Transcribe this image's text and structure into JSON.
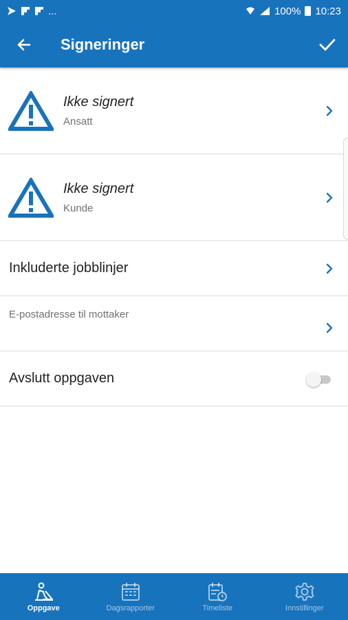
{
  "status_bar": {
    "battery": "100%",
    "time": "10:23",
    "more_notifications": "..."
  },
  "app_bar": {
    "title": "Signeringer"
  },
  "signatures": [
    {
      "status": "Ikke signert",
      "role": "Ansatt"
    },
    {
      "status": "Ikke signert",
      "role": "Kunde"
    }
  ],
  "included_lines": {
    "label": "Inkluderte jobblinjer"
  },
  "email": {
    "label": "E-postadresse til mottaker",
    "value": ""
  },
  "finish": {
    "label": "Avslutt oppgaven",
    "enabled": false
  },
  "bottom_nav": {
    "items": [
      {
        "label": "Oppgave",
        "icon": "worker-icon",
        "active": true
      },
      {
        "label": "Dagsrapporter",
        "icon": "calendar-icon",
        "active": false
      },
      {
        "label": "Timeliste",
        "icon": "timesheet-icon",
        "active": false
      },
      {
        "label": "Innstillinger",
        "icon": "gear-icon",
        "active": false
      }
    ]
  },
  "colors": {
    "primary": "#1873bd",
    "warning_icon": "#1873bd",
    "divider": "#dcdcdc"
  }
}
